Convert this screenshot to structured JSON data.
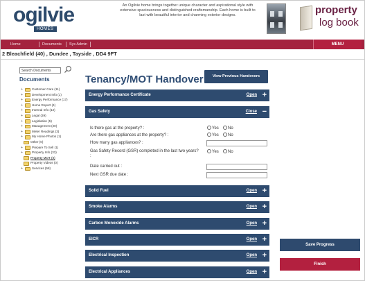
{
  "header": {
    "logo": "ogilvie",
    "logo_sub": "HOMES",
    "blurb": "An Ogilvie home brings together unique character and aspirational style with extensive spaciousness and distinguished craftsmanship. Each home is built to last with beautiful interior and charming exterior designs.",
    "brand_line1": "property",
    "brand_line2": "log book"
  },
  "nav": {
    "home": "Home",
    "documents": "Documents",
    "sys_admin": "Sys Admin",
    "menu": "MENU"
  },
  "address": "2 Bleachfield (40) , Dundee , Tayside , DD4 9FT",
  "sidebar": {
    "search_placeholder": "Search Documents",
    "title": "Documents",
    "tree": [
      {
        "label": "Customer Care (11)",
        "level": 0,
        "expand": "+"
      },
      {
        "label": "Development Info (1)",
        "level": 0,
        "expand": "+"
      },
      {
        "label": "Energy Performance (17)",
        "level": 0,
        "expand": "+"
      },
      {
        "label": "Home Report (4)",
        "level": 0,
        "expand": "+"
      },
      {
        "label": "Internal Info (12)",
        "level": 0,
        "expand": "+"
      },
      {
        "label": "Legal (39)",
        "level": 0,
        "expand": "+"
      },
      {
        "label": "Legislation (5)",
        "level": 0,
        "expand": "+"
      },
      {
        "label": "Management (20)",
        "level": 0,
        "expand": "+"
      },
      {
        "label": "Meter Readings (3)",
        "level": 0,
        "expand": "+"
      },
      {
        "label": "My Home Photos (1)",
        "level": 0,
        "expand": "+"
      },
      {
        "label": "Other (0)",
        "level": 1,
        "expand": ""
      },
      {
        "label": "Prepare To Sell (1)",
        "level": 0,
        "expand": "+"
      },
      {
        "label": "Property Info (33)",
        "level": 0,
        "expand": "+"
      },
      {
        "label": "Property MOT (0)",
        "level": 1,
        "expand": "",
        "current": true
      },
      {
        "label": "Property Videos (0)",
        "level": 1,
        "expand": ""
      },
      {
        "label": "Services (58)",
        "level": 0,
        "expand": "+"
      }
    ]
  },
  "main": {
    "title": "Tenancy/MOT Handover",
    "view_previous": "View Previous Handovers",
    "sections": [
      {
        "title": "Energy Performance Certificate",
        "action": "Open",
        "symbol": "+"
      },
      {
        "title": "Gas Safety",
        "action": "Close",
        "symbol": "−"
      },
      {
        "title": "Solid Fuel",
        "action": "Open",
        "symbol": "+"
      },
      {
        "title": "Smoke Alarms",
        "action": "Open",
        "symbol": "+"
      },
      {
        "title": "Carbon Monoxide Alarms",
        "action": "Open",
        "symbol": "+"
      },
      {
        "title": "EICR",
        "action": "Open",
        "symbol": "+"
      },
      {
        "title": "Electrical Inspection",
        "action": "Open",
        "symbol": "+"
      },
      {
        "title": "Electrical Appliances",
        "action": "Open",
        "symbol": "+"
      }
    ],
    "gas_safety": {
      "q1": "Is there gas at the property? :",
      "q2": "Are there gas appliances at the property? :",
      "q3": "How many gas appliances? :",
      "q4": "Gas Safety Record (GSR) completed in the last two years? :",
      "q5": "Date carried out :",
      "q6": "Next GSR due date :",
      "yes": "Yes",
      "no": "No"
    }
  },
  "actions": {
    "save": "Save Progress",
    "finish": "Finish"
  },
  "colors": {
    "brand_navy": "#2e4b6f",
    "brand_red": "#b3203f",
    "folder": "#f3d36b"
  }
}
